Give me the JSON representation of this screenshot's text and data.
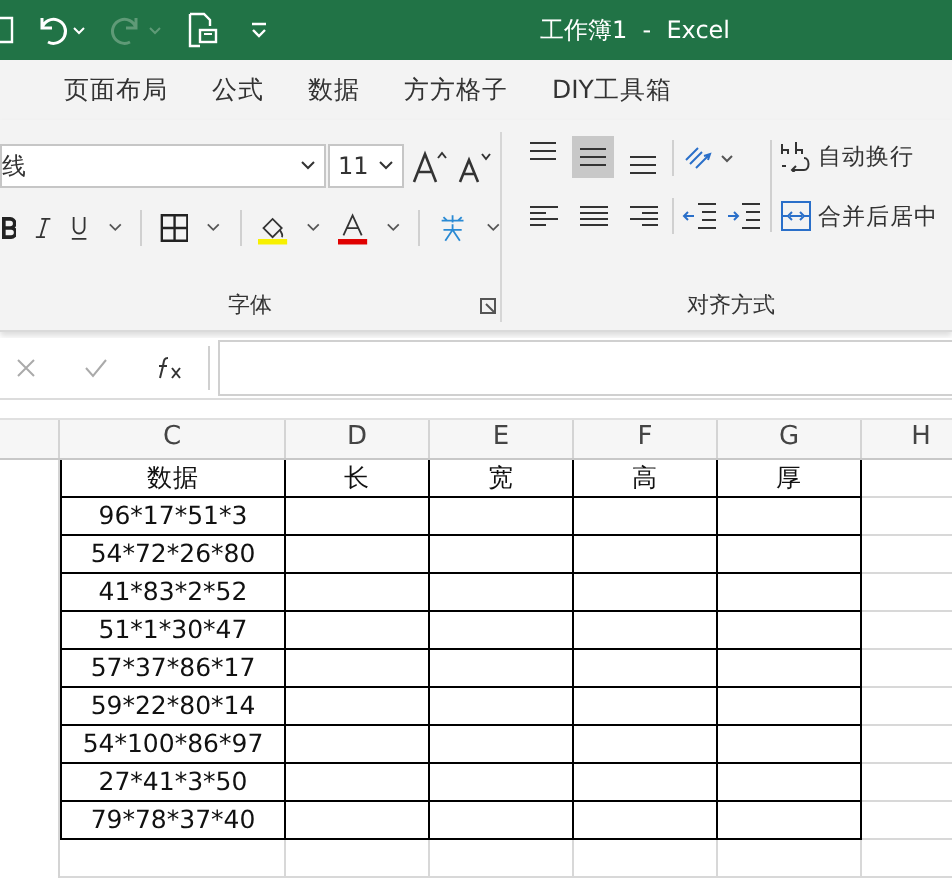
{
  "window": {
    "title": "工作簿1  -  Excel"
  },
  "tabs": [
    {
      "label": "页面布局"
    },
    {
      "label": "公式"
    },
    {
      "label": "数据"
    },
    {
      "label": "方方格子"
    },
    {
      "label": "DIY工具箱"
    }
  ],
  "font_group": {
    "font_name": "线",
    "font_size": "11",
    "label": "字体"
  },
  "alignment_group": {
    "label": "对齐方式",
    "wrap_text": "自动换行",
    "merge_center": "合并后居中",
    "align_buttons": [
      {
        "kind": "top",
        "selected": false
      },
      {
        "kind": "middle",
        "selected": true
      },
      {
        "kind": "bottom",
        "selected": false
      },
      {
        "kind": "left",
        "selected": false
      },
      {
        "kind": "center",
        "selected": false
      },
      {
        "kind": "right",
        "selected": false
      }
    ]
  },
  "sheet": {
    "columns": [
      "C",
      "D",
      "E",
      "F",
      "G",
      "H"
    ],
    "header": [
      "数据",
      "长",
      "宽",
      "高",
      "厚"
    ],
    "rows": [
      "96*17*51*3",
      "54*72*26*80",
      "41*83*2*52",
      "51*1*30*47",
      "57*37*86*17",
      "59*22*80*14",
      "54*100*86*97",
      "27*41*3*50",
      "79*78*37*40"
    ]
  }
}
